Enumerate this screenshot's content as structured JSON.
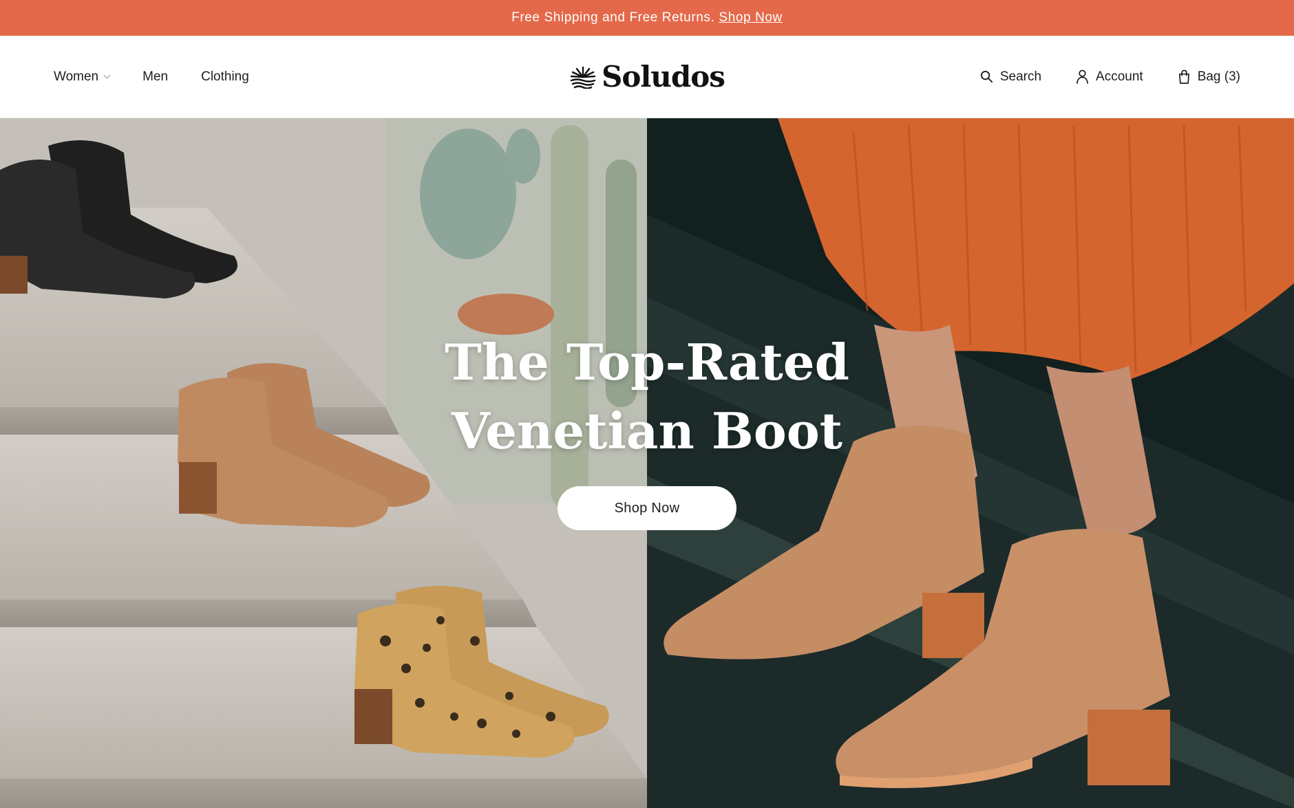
{
  "announcement": {
    "text": "Free Shipping and Free Returns.",
    "link_label": "Shop Now"
  },
  "nav": {
    "items": [
      {
        "label": "Women",
        "has_dropdown": true
      },
      {
        "label": "Men"
      },
      {
        "label": "Clothing"
      }
    ]
  },
  "brand": {
    "name": "Soludos"
  },
  "utility": {
    "search_label": "Search",
    "account_label": "Account",
    "bag_label": "Bag (3)"
  },
  "hero": {
    "title_line1": "The Top-Rated",
    "title_line2": "Venetian Boot",
    "cta_label": "Shop Now"
  },
  "colors": {
    "announcement_bg": "#e4694a",
    "text_primary": "#1d1d1d",
    "cta_bg": "#ffffff"
  }
}
